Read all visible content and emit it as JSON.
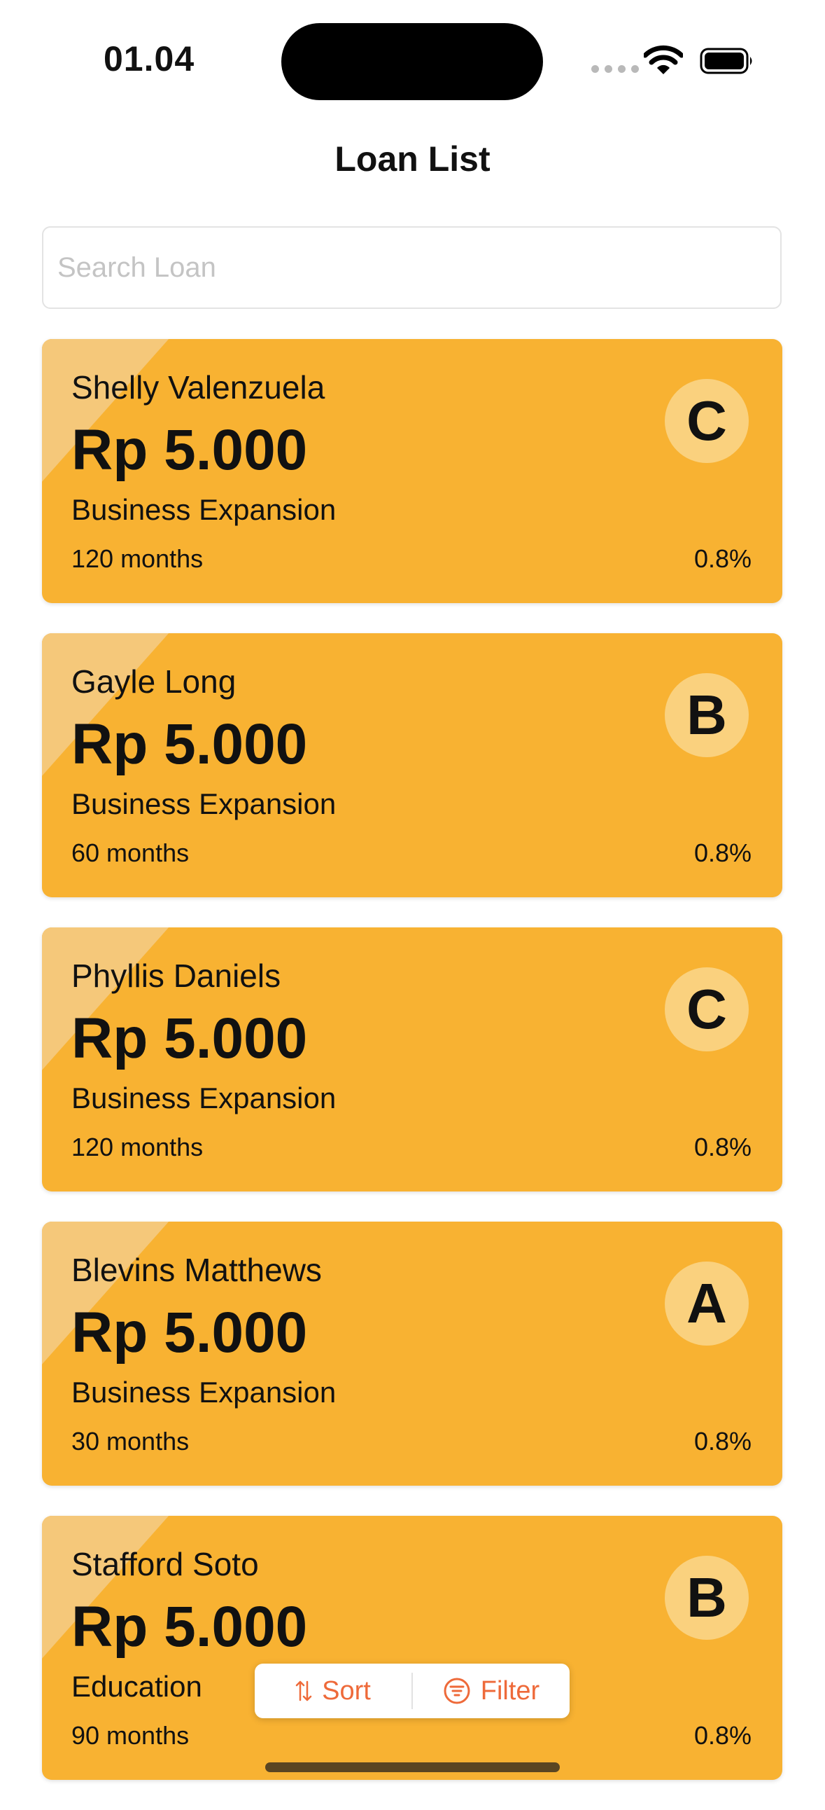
{
  "status_bar": {
    "time": "01.04"
  },
  "header": {
    "title": "Loan List"
  },
  "search": {
    "placeholder": "Search Loan",
    "value": ""
  },
  "loans": [
    {
      "name": "Shelly Valenzuela",
      "amount": "Rp 5.000",
      "purpose": "Business Expansion",
      "tenor": "120 months",
      "rate": "0.8%",
      "grade": "C"
    },
    {
      "name": "Gayle Long",
      "amount": "Rp 5.000",
      "purpose": "Business Expansion",
      "tenor": "60 months",
      "rate": "0.8%",
      "grade": "B"
    },
    {
      "name": "Phyllis Daniels",
      "amount": "Rp 5.000",
      "purpose": "Business Expansion",
      "tenor": "120 months",
      "rate": "0.8%",
      "grade": "C"
    },
    {
      "name": "Blevins Matthews",
      "amount": "Rp 5.000",
      "purpose": "Business Expansion",
      "tenor": "30 months",
      "rate": "0.8%",
      "grade": "A"
    },
    {
      "name": "Stafford Soto",
      "amount": "Rp 5.000",
      "purpose": "Education",
      "tenor": "90 months",
      "rate": "0.8%",
      "grade": "B"
    }
  ],
  "toolbar": {
    "sort_label": "Sort",
    "filter_label": "Filter",
    "sort_icon": "sort-arrows-icon",
    "filter_icon": "filter-icon"
  },
  "colors": {
    "card_background": "#f8b232",
    "grade_badge": "#fad17e",
    "accent": "#ee6a3a"
  }
}
